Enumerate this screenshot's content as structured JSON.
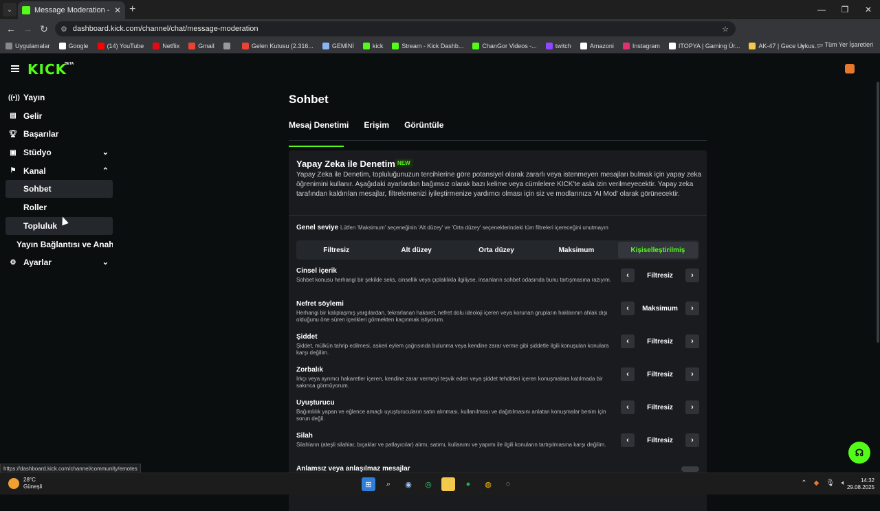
{
  "browser": {
    "tab_title": "Message Moderation - Kick Da",
    "url": "dashboard.kick.com/channel/chat/message-moderation",
    "bookmarks": [
      {
        "label": "Uygulamalar",
        "color": "#888888"
      },
      {
        "label": "Google",
        "color": "#ffffff"
      },
      {
        "label": "(14) YouTube",
        "color": "#ff0000"
      },
      {
        "label": "Netflix",
        "color": "#e50914"
      },
      {
        "label": "Gmail",
        "color": "#ea4335"
      },
      {
        "label": "",
        "color": "#999999"
      },
      {
        "label": "Gelen Kutusu (2.316...",
        "color": "#ea4335"
      },
      {
        "label": "GEMİNİ",
        "color": "#8ab4f8"
      },
      {
        "label": "kick",
        "color": "#53fc18"
      },
      {
        "label": "Stream - Kick Dashb...",
        "color": "#53fc18"
      },
      {
        "label": "ChanGor Videos -...",
        "color": "#53fc18"
      },
      {
        "label": "twitch",
        "color": "#9146ff"
      },
      {
        "label": "Amazoni",
        "color": "#ffffff"
      },
      {
        "label": "Instagram",
        "color": "#e1306c"
      },
      {
        "label": "ITOPYA | Gaming Ür...",
        "color": "#ffffff"
      },
      {
        "label": "AK-47 | Gece Uykus...",
        "color": "#f2c94c"
      }
    ],
    "all_bookmarks": "Tüm Yer İşaretleri",
    "status_url": "https://dashboard.kick.com/channel/community/emotes"
  },
  "header": {
    "logo": "KICK",
    "beta": "BETA"
  },
  "sidebar": {
    "items": [
      {
        "label": "Yayın",
        "icon": "broadcast-icon"
      },
      {
        "label": "Gelir",
        "icon": "revenue-icon"
      },
      {
        "label": "Başarılar",
        "icon": "trophy-icon"
      },
      {
        "label": "Stüdyo",
        "icon": "studio-icon"
      },
      {
        "label": "Kanal",
        "icon": "channel-icon"
      },
      {
        "label": "Sohbet"
      },
      {
        "label": "Roller"
      },
      {
        "label": "Topluluk"
      },
      {
        "label": "Yayın Bağlantısı ve Anahtarı"
      },
      {
        "label": "Ayarlar",
        "icon": "gear-icon"
      }
    ]
  },
  "main": {
    "title": "Sohbet",
    "tabs": [
      "Mesaj Denetimi",
      "Erişim",
      "Görüntüle"
    ],
    "ai": {
      "title": "Yapay Zeka ile Denetim",
      "badge": "NEW",
      "description": "Yapay Zeka ile Denetim, topluluğunuzun tercihlerine göre potansiyel olarak zararlı veya istenmeyen mesajları bulmak için yapay zeka öğrenimini kullanır. Aşağıdaki ayarlardan bağımsız olarak bazı kelime veya cümlelere KICK'te asla izin verilmeyecektir. Yapay zeka tarafından kaldırılan mesajlar, filtrelemenizi iyileştirmenize yardımcı olması için siz ve modlarınıza 'AI Mod' olarak görünecektir."
    },
    "level": {
      "label": "Genel seviye",
      "hint": "Lütfen 'Maksimum' seçeneğinin 'Alt düzey' ve 'Orta düzey' seçeneklerindeki tüm filtreleri içereceğini unutmayın",
      "options": [
        "Filtresiz",
        "Alt düzey",
        "Orta düzey",
        "Maksimum",
        "Kişiselleştirilmiş"
      ],
      "selected": "Kişiselleştirilmiş"
    },
    "rules": [
      {
        "name": "Cinsel içerik",
        "desc": "Sohbet konusu herhangi bir şekilde seks, cinsellik veya çıplaklıkla ilgiliyse, insanların sohbet odasında bunu tartışmasına razıyım.",
        "value": "Filtresiz"
      },
      {
        "name": "Nefret söylemi",
        "desc": "Herhangi bir kalıplaşmış yargılardan, tekrarlanan hakaret, nefret dolu ideoloji içeren veya korunan grupların haklarının ahlak dışı olduğunu öne süren içerikleri görmekten kaçınmak istiyorum.",
        "value": "Maksimum"
      },
      {
        "name": "Şiddet",
        "desc": "Şiddet, mülkün tahrip edilmesi, askeri eylem çağrısında bulunma veya kendine zarar verme gibi şiddetle ilgili konuşulan konulara karşı değilim.",
        "value": "Filtresiz"
      },
      {
        "name": "Zorbalık",
        "desc": "Irkçı veya ayrımcı hakaretler içeren, kendine zarar vermeyi teşvik eden veya şiddet tehditleri içeren konuşmalara katılmada bir sakınca görmüyorum.",
        "value": "Filtresiz"
      },
      {
        "name": "Uyuşturucu",
        "desc": "Bağımlılık yapan ve eğlence amaçlı uyuşturucuların satın alınması, kullanılması ve dağıtılmasını anlatan konuşmalar benim için sorun değil.",
        "value": "Filtresiz"
      },
      {
        "name": "Silah",
        "desc": "Silahların (ateşli silahlar, bıçaklar ve patlayıcılar) alımı, satımı, kullanımı ve yapımı ile ilgili konuların tartışılmasına karşı değilim.",
        "value": "Filtresiz"
      },
      {
        "name": "Anlamsız veya anlaşılmaz mesajlar",
        "desc": "",
        "value": ""
      }
    ]
  },
  "taskbar": {
    "temp": "28°C",
    "condition": "Güneşli",
    "time": "14:32",
    "date": "29.08.2025"
  },
  "colors": {
    "accent": "#53fc18",
    "background": "#0b0e0f",
    "card": "#191b1f"
  }
}
